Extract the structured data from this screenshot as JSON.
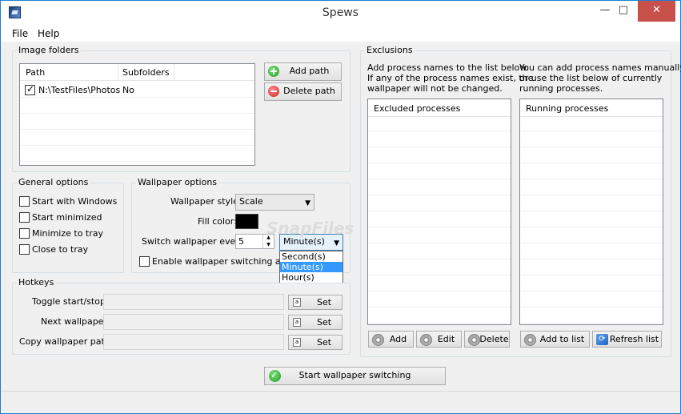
{
  "window": {
    "title": "Spews",
    "min": "—",
    "max": "□",
    "close": "✕"
  },
  "menu": [
    "File",
    "Help"
  ],
  "image_folders": {
    "legend": "Image folders",
    "columns": [
      "Path",
      "Subfolders"
    ],
    "rows": [
      {
        "path": "N:\\TestFiles\\Photos",
        "subfolders": "No",
        "checked": true
      }
    ],
    "add_label": "Add path",
    "delete_label": "Delete path"
  },
  "general": {
    "legend": "General options",
    "options": [
      "Start with Windows",
      "Start minimized",
      "Minimize to tray",
      "Close to tray"
    ]
  },
  "wallpaper": {
    "legend": "Wallpaper options",
    "style_label": "Wallpaper style:",
    "style_value": "Scale",
    "fill_label": "Fill color:",
    "fill_color": "#000000",
    "switch_label": "Switch wallpaper every:",
    "switch_value": "5",
    "unit_value": "Minute(s)",
    "unit_options": [
      "Second(s)",
      "Minute(s)",
      "Hour(s)"
    ],
    "enable_label": "Enable wallpaper switching at star"
  },
  "hotkeys": {
    "legend": "Hotkeys",
    "items": [
      {
        "label": "Toggle start/stop:",
        "button": "Set"
      },
      {
        "label": "Next wallpaper:",
        "button": "Set"
      },
      {
        "label": "Copy wallpaper path:",
        "button": "Set"
      }
    ]
  },
  "exclusions": {
    "legend": "Exclusions",
    "left_desc": [
      "Add process names to the list below.",
      "If any of the process names exist, the",
      "wallpaper will not be changed."
    ],
    "right_desc": [
      "You can add process names manually",
      "or use the list below of currently",
      "running processes."
    ],
    "excluded_header": "Excluded processes",
    "running_header": "Running processes",
    "add_label": "Add",
    "edit_label": "Edit",
    "delete_label": "Delete",
    "addlist_label": "Add to list",
    "refresh_label": "Refresh list"
  },
  "start_label": "Start wallpaper switching",
  "watermark": "SnapFiles"
}
